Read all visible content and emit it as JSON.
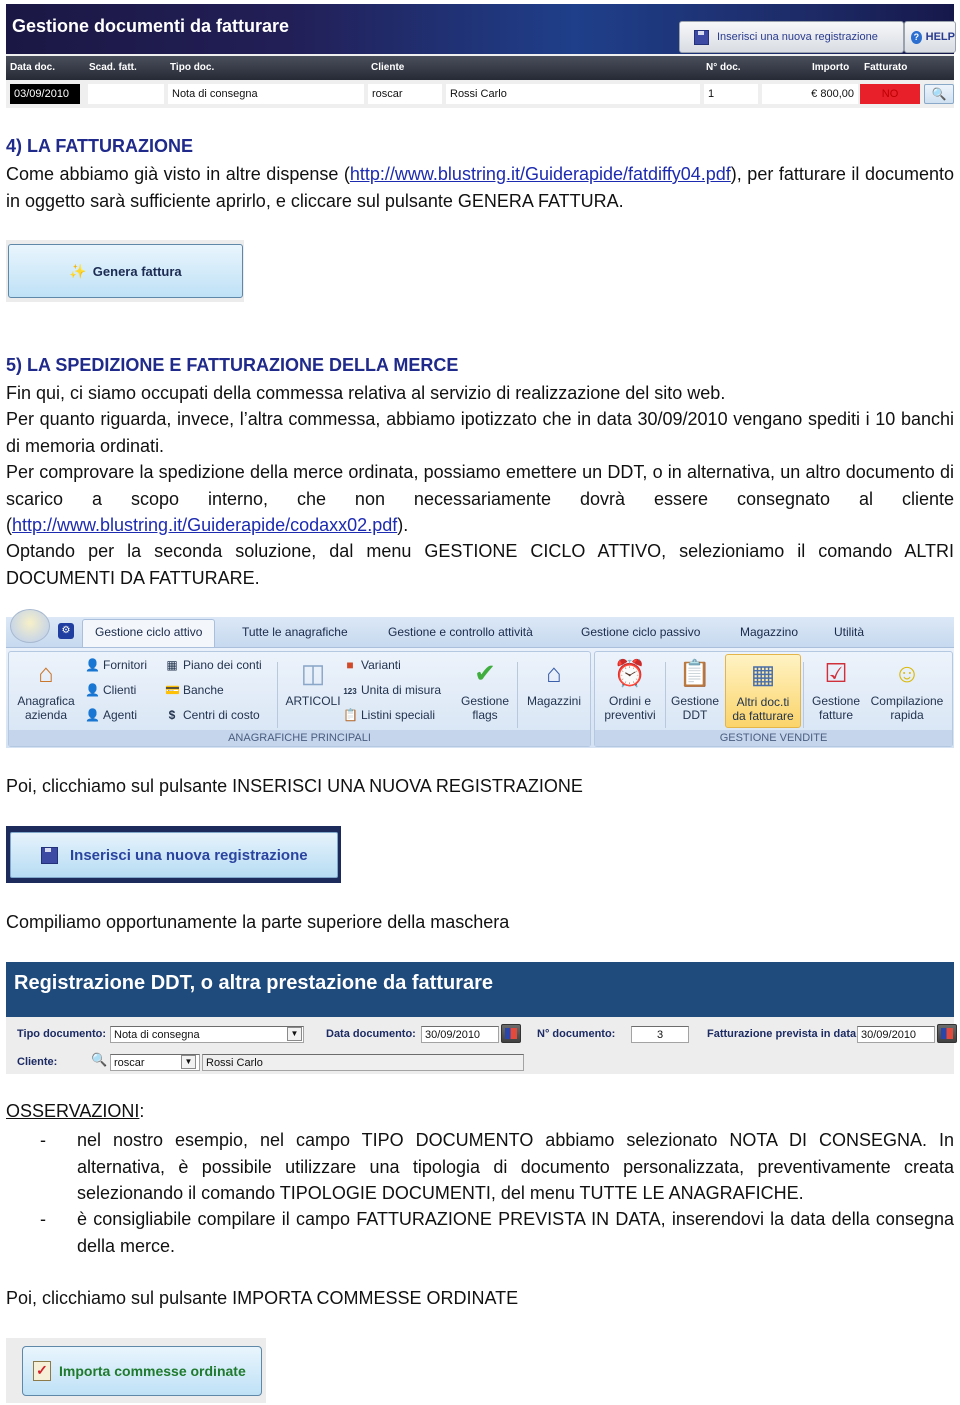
{
  "doc_list_window": {
    "title": "Gestione documenti da fatturare",
    "new_button": "Inserisci una nuova registrazione",
    "help_button": "HELP",
    "columns": [
      "Data doc.",
      "Scad. fatt.",
      "Tipo doc.",
      "Cliente",
      "N° doc.",
      "Importo",
      "Fatturato"
    ],
    "row": {
      "data_doc": "03/09/2010",
      "scad_fatt": "",
      "tipo_doc": "Nota di consegna",
      "cliente_code": "roscar",
      "cliente_name": "Rossi Carlo",
      "n_doc": "1",
      "importo": "€ 800,00",
      "fatturato": "NO"
    },
    "colors": {
      "fatturato_no": "#e8202a",
      "header": "#1f3f8a"
    }
  },
  "section4": {
    "heading": "4) LA FATTURAZIONE",
    "p1_before": "Come abbiamo già visto in altre dispense (",
    "p1_link": "http://www.blustring.it/Guiderapide/fatdiffy04.pdf",
    "p1_after": "), per fatturare il documento in oggetto sarà sufficiente aprirlo, e cliccare sul pulsante GENERA FATTURA.",
    "genera_button": "Genera fattura"
  },
  "section5": {
    "heading": "5) LA SPEDIZIONE E FATTURAZIONE DELLA MERCE",
    "p1": "Fin qui, ci siamo occupati della commessa relativa al servizio di realizzazione del sito web.",
    "p2": "Per quanto riguarda, invece, l’altra commessa, abbiamo ipotizzato che in data 30/09/2010 vengano spediti i 10 banchi di memoria ordinati.",
    "p3_before": "Per comprovare la spedizione della merce ordinata, possiamo emettere un DDT, o in alternativa, un altro documento di scarico a scopo interno, che non necessariamente dovrà essere consegnato al cliente (",
    "p3_link": "http://www.blustring.it/Guiderapide/codaxx02.pdf",
    "p3_after": ").",
    "p4": "Optando per la seconda soluzione, dal menu GESTIONE CICLO ATTIVO, selezioniamo il comando ALTRI DOCUMENTI DA FATTURARE."
  },
  "ribbon": {
    "tabs": [
      "Gestione ciclo attivo",
      "Tutte le anagrafiche",
      "Gestione e controllo attività",
      "Gestione ciclo passivo",
      "Magazzino",
      "Utilità"
    ],
    "group1": {
      "label": "ANAGRAFICHE PRINCIPALI",
      "anagrafica_azienda": "Anagrafica azienda",
      "fornitori": "Fornitori",
      "clienti": "Clienti",
      "agenti": "Agenti",
      "piano_conti": "Piano dei conti",
      "banche": "Banche",
      "centri_costo": "Centri di costo",
      "articoli": "ARTICOLI",
      "varianti": "Varianti",
      "unita_misura": "Unita di misura",
      "listini": "Listini speciali",
      "gestione_flags_1": "Gestione",
      "gestione_flags_2": "flags",
      "magazzini": "Magazzini"
    },
    "group2": {
      "label": "GESTIONE VENDITE",
      "ordini_1": "Ordini e",
      "ordini_2": "preventivi",
      "ddt_1": "Gestione",
      "ddt_2": "DDT",
      "altri_1": "Altri doc.ti",
      "altri_2": "da fatturare",
      "fatture_1": "Gestione",
      "fatture_2": "fatture",
      "rapida_1": "Compilazione",
      "rapida_2": "rapida"
    }
  },
  "step_inserisci": {
    "text": "Poi, clicchiamo sul pulsante INSERISCI UNA NUOVA REGISTRAZIONE",
    "button": "Inserisci una nuova registrazione"
  },
  "step_compila": {
    "text": "Compiliamo opportunamente la parte superiore della maschera"
  },
  "reg_form": {
    "title": "Registrazione DDT, o altra prestazione da fatturare",
    "tipo_label": "Tipo documento:",
    "tipo_value": "Nota di consegna",
    "data_label": "Data documento:",
    "data_value": "30/09/2010",
    "ndoc_label": "N° documento:",
    "ndoc_value": "3",
    "prevista_label": "Fatturazione prevista in data:",
    "prevista_value": "30/09/2010",
    "cliente_label": "Cliente:",
    "cliente_code": "roscar",
    "cliente_name": "Rossi Carlo"
  },
  "observations": {
    "title": "OSSERVAZIONI",
    "colon": ":",
    "bullet": "-",
    "items": [
      "nel nostro esempio, nel campo TIPO DOCUMENTO abbiamo selezionato NOTA DI CONSEGNA. In alternativa, è possibile utilizzare una tipologia di documento personalizzata, preventivamente creata selezionando il comando TIPOLOGIE DOCUMENTI, del menu TUTTE LE ANAGRAFICHE.",
      "è consigliabile compilare il campo FATTURAZIONE PREVISTA IN DATA, inserendovi la data della consegna della merce."
    ]
  },
  "step_importa": {
    "text": "Poi, clicchiamo sul pulsante IMPORTA COMMESSE ORDINATE",
    "button": "Importa commesse ordinate"
  }
}
